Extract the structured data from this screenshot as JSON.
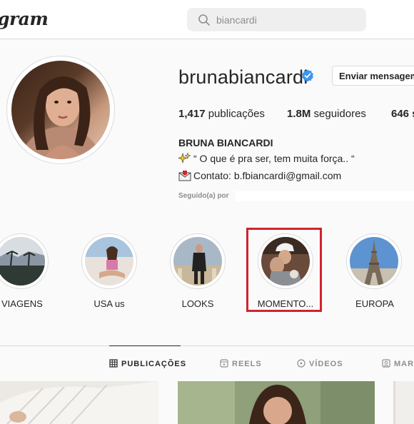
{
  "header": {
    "logo_text": "gram",
    "search_value": "biancardi"
  },
  "profile": {
    "username": "brunabiancardi",
    "verified_icon": "verified-badge-icon",
    "message_button": "Enviar mensagem",
    "stats": {
      "posts_count": "1,417",
      "posts_label": " publicações",
      "followers_count": "1.8M",
      "followers_label": " seguidores",
      "following_count": "646 s"
    },
    "full_name": "BRUNA BIANCARDI",
    "bio_line1": "“ O que é pra ser, tem muita força.. “",
    "bio_line2": "Contato: b.fbiancardi@gmail.com",
    "followed_by_label": "Seguido(a) por"
  },
  "highlights": [
    {
      "label": "VIAGENS"
    },
    {
      "label": "USA us"
    },
    {
      "label": "LOOKS"
    },
    {
      "label": "MOMENTO..."
    },
    {
      "label": "EUROPA"
    }
  ],
  "tabs": [
    {
      "label": "PUBLICAÇÕES",
      "icon": "grid-icon"
    },
    {
      "label": "REELS",
      "icon": "reels-icon"
    },
    {
      "label": "VÍDEOS",
      "icon": "play-icon"
    },
    {
      "label": "MAR",
      "icon": "tag-icon"
    }
  ],
  "colors": {
    "accent_verified": "#3897f0",
    "highlight_box": "#d0242b",
    "text_primary": "#262626",
    "text_secondary": "#8e8e8e"
  }
}
